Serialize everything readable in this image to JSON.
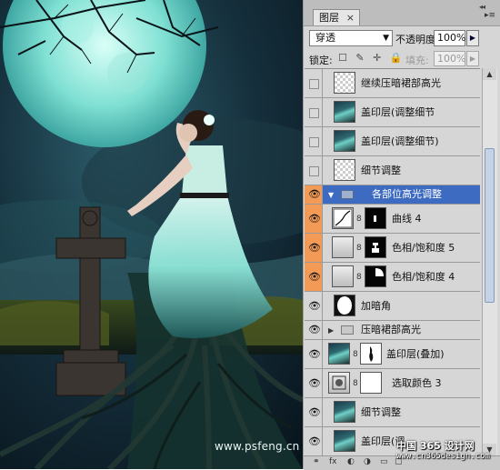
{
  "artwork": {
    "watermark": "www.psfeng.cn"
  },
  "panel": {
    "tab_label": "图层",
    "tab_close": "×",
    "collapse_glyph": "◂◂",
    "menu_glyph": "▸≡",
    "blend_mode": "穿透",
    "opacity_label": "不透明度:",
    "opacity_value": "100%",
    "lock_label": "锁定:",
    "lock_icons": "☐ ✎ ✛ 🔒",
    "fill_label": "填充:",
    "fill_value": "100%"
  },
  "layers": [
    {
      "name": "继续压暗裙部高光",
      "type": "pixel",
      "thumb": "trans",
      "visible": false
    },
    {
      "name": "盖印层(调整细节",
      "type": "pixel",
      "thumb": "scene",
      "visible": false
    },
    {
      "name": "盖印层(调整细节)",
      "type": "pixel",
      "thumb": "scene",
      "visible": false
    },
    {
      "name": "细节调整",
      "type": "pixel",
      "thumb": "trans",
      "visible": false
    },
    {
      "name": "各部位高光调整",
      "type": "group",
      "expanded": true,
      "selected": true,
      "visible": true
    },
    {
      "name": "曲线 4",
      "type": "adjustment",
      "mask": "black",
      "child": true,
      "visible": true
    },
    {
      "name": "色相/饱和度 5",
      "type": "adjustment",
      "mask": "black",
      "child": true,
      "visible": true
    },
    {
      "name": "色相/饱和度 4",
      "type": "adjustment",
      "mask": "black",
      "child": true,
      "visible": true
    },
    {
      "name": "加暗角",
      "type": "pixel",
      "thumb": "trans",
      "visible": true
    },
    {
      "name": "压暗裙部高光",
      "type": "group",
      "expanded": false,
      "visible": true
    },
    {
      "name": "盖印层(叠加)",
      "type": "pixel-mask",
      "thumb": "scene",
      "mask": "white",
      "visible": true
    },
    {
      "name": "选取颜色 3",
      "type": "adjustment",
      "mask": "white",
      "visible": true
    },
    {
      "name": "细节调整",
      "type": "pixel",
      "thumb": "scene",
      "visible": true
    },
    {
      "name": "盖印层(调",
      "type": "pixel",
      "thumb": "scene",
      "visible": true
    }
  ],
  "icons": {
    "eye": "eye-icon",
    "chain": "chain-link-icon",
    "folder": "folder-icon",
    "scroll_up": "scroll-up-icon",
    "scroll_down": "scroll-down-icon"
  },
  "bottom_icons": [
    "⚭",
    "fx",
    "◐",
    "◑",
    "▭",
    "▢",
    "🗑"
  ],
  "site_watermark": {
    "line1": "中国 365 设计网",
    "line2": "www.cn365design.com"
  },
  "colors": {
    "selected_row": "#3d6bc2",
    "eye_highlight": "#f39a57",
    "panel_bg": "#d6d6d6"
  }
}
